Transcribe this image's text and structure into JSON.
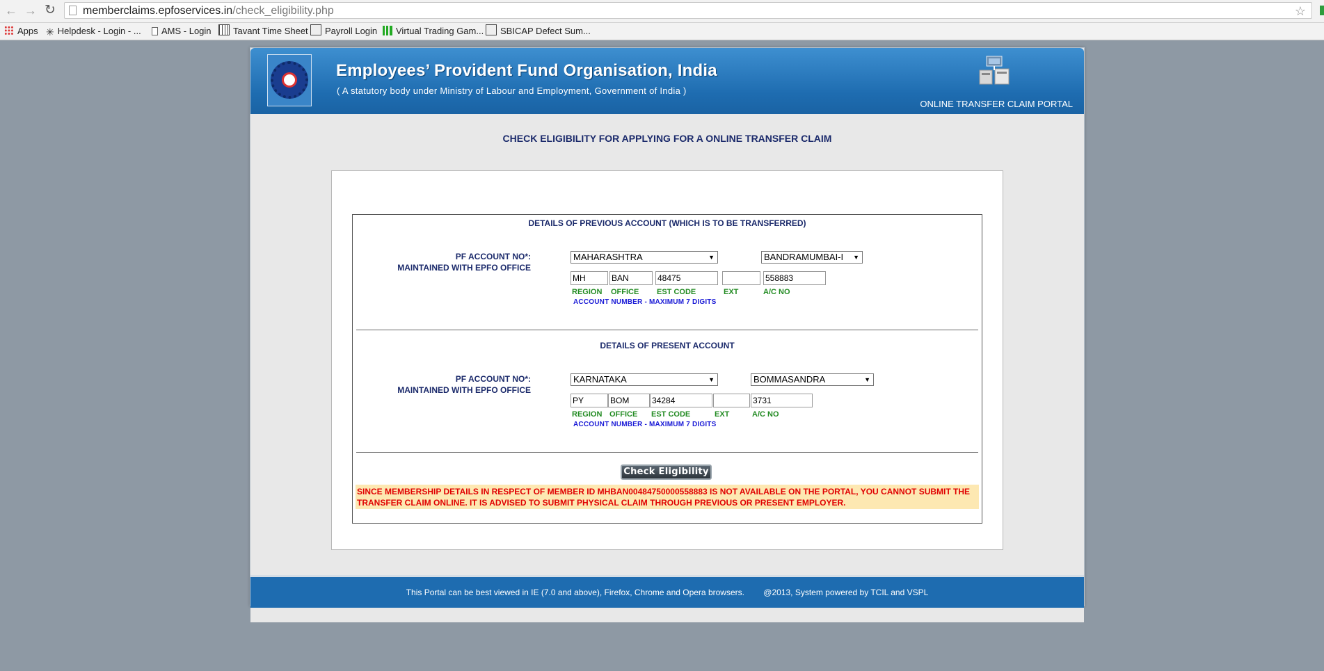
{
  "browser": {
    "url_host": "memberclaims.epfoservices.in",
    "url_path": "/check_eligibility.php",
    "bookmarks": [
      "Apps",
      "Helpdesk - Login - ...",
      "AMS - Login",
      "Tavant Time Sheet",
      "Payroll Login",
      "Virtual Trading Gam...",
      "SBICAP Defect Sum..."
    ]
  },
  "header": {
    "title": "Employees’ Provident Fund Organisation, India",
    "subtitle": "( A statutory body under Ministry of Labour and Employment, Government of India )",
    "portal_name": "ONLINE TRANSFER CLAIM PORTAL"
  },
  "main": {
    "heading": "CHECK ELIGIBILITY FOR APPLYING FOR A ONLINE TRANSFER CLAIM",
    "previous": {
      "title": "DETAILS OF PREVIOUS ACCOUNT (WHICH IS TO BE TRANSFERRED)",
      "label_line1": "PF ACCOUNT NO*:",
      "label_line2": "MAINTAINED WITH EPFO OFFICE",
      "state": "MAHARASHTRA",
      "office": "BANDRAMUMBAI-I",
      "region": "MH",
      "office_code": "BAN",
      "est_code": "48475",
      "ext": "",
      "ac_no": "558883"
    },
    "present": {
      "title": "DETAILS OF PRESENT ACCOUNT",
      "label_line1": "PF ACCOUNT NO*:",
      "label_line2": "MAINTAINED WITH EPFO OFFICE",
      "state": "KARNATAKA",
      "office": "BOMMASANDRA",
      "region": "PY",
      "office_code": "BOM",
      "est_code": "34284",
      "ext": "",
      "ac_no": "3731"
    },
    "sub_labels": {
      "region": "REGION",
      "office": "OFFICE",
      "est_code": "EST CODE",
      "ext": "EXT",
      "ac_no": "A/C NO"
    },
    "hint": "ACCOUNT NUMBER - MAXIMUM 7 DIGITS",
    "check_button": "Check Eligibility",
    "error_message": "SINCE MEMBERSHIP DETAILS IN RESPECT OF MEMBER ID MHBAN00484750000558883 IS NOT AVAILABLE ON THE PORTAL, YOU CANNOT SUBMIT THE TRANSFER CLAIM ONLINE. IT IS ADVISED TO SUBMIT PHYSICAL CLAIM THROUGH PREVIOUS OR PRESENT EMPLOYER."
  },
  "footer": {
    "browsers_note": "This Portal can be best viewed in IE (7.0 and above), Firefox, Chrome and Opera browsers.",
    "copyright": "@2013, System powered by TCIL and VSPL"
  },
  "colors": {
    "header_blue": "#1e6cb0",
    "heading_navy": "#1b2a6b",
    "label_green": "#228b22",
    "hint_blue": "#1a1ad6",
    "error_red": "#e00000",
    "error_bg": "#fde8b2"
  }
}
